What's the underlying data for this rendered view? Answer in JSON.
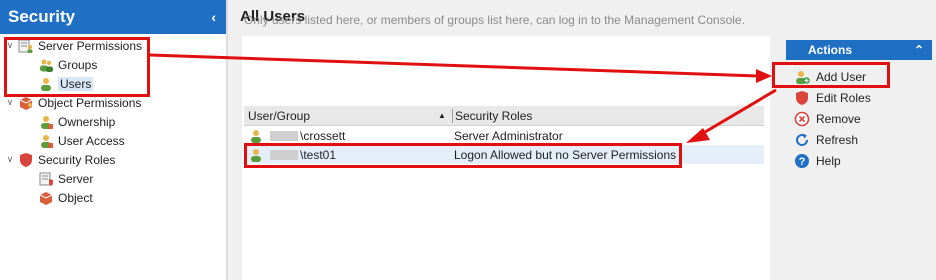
{
  "sidebar": {
    "title": "Security",
    "collapse_glyph": "‹",
    "tree": [
      {
        "label": "Server Permissions",
        "icon": "server-permissions-icon",
        "level": 0,
        "expanded": true
      },
      {
        "label": "Groups",
        "icon": "groups-icon",
        "level": 1
      },
      {
        "label": "Users",
        "icon": "users-icon",
        "level": 1,
        "selected": true
      },
      {
        "label": "Object Permissions",
        "icon": "object-permissions-icon",
        "level": 0,
        "expanded": true
      },
      {
        "label": "Ownership",
        "icon": "ownership-icon",
        "level": 1
      },
      {
        "label": "User Access",
        "icon": "user-access-icon",
        "level": 1
      },
      {
        "label": "Security Roles",
        "icon": "shield-icon",
        "level": 0,
        "expanded": true
      },
      {
        "label": "Server",
        "icon": "server-role-icon",
        "level": 1
      },
      {
        "label": "Object",
        "icon": "object-role-icon",
        "level": 1
      }
    ]
  },
  "main": {
    "title": "All Users",
    "info_text": "Only users listed here, or members of groups list here, can log in to the Management Console.",
    "grid": {
      "columns": [
        "User/Group",
        "Security Roles"
      ],
      "rows": [
        {
          "user": "\\crossett",
          "role": "Server Administrator"
        },
        {
          "user": "\\test01",
          "role": "Logon Allowed but no Server Permissions"
        }
      ]
    }
  },
  "actions": {
    "title": "Actions",
    "collapse_glyph": "⌃",
    "items": [
      {
        "label": "Add User",
        "icon": "add-user-icon"
      },
      {
        "label": "Edit Roles",
        "icon": "edit-roles-icon"
      },
      {
        "label": "Remove",
        "icon": "remove-icon"
      },
      {
        "label": "Refresh",
        "icon": "refresh-icon"
      },
      {
        "label": "Help",
        "icon": "help-icon"
      }
    ]
  },
  "colors": {
    "accent": "#1f6fc5",
    "annotation": "#e01010"
  }
}
